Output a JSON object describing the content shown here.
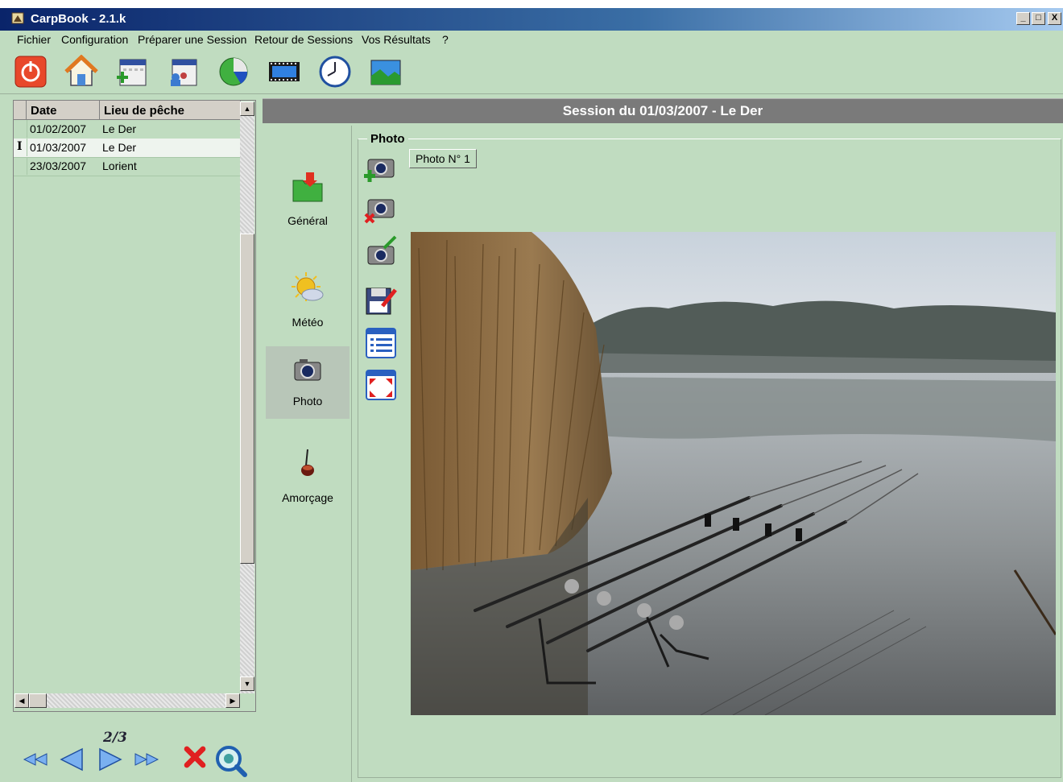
{
  "window": {
    "title": "CarpBook - 2.1.k",
    "min": "_",
    "max": "□",
    "close": "X"
  },
  "menu": {
    "items": [
      {
        "label": "Fichier"
      },
      {
        "label": "Configuration"
      },
      {
        "label": "Préparer une Session"
      },
      {
        "label": "Retour de Sessions"
      },
      {
        "label": "Vos Résultats"
      },
      {
        "label": "?"
      }
    ]
  },
  "toolbar": {
    "icons": [
      "power-icon",
      "home-icon",
      "calendar-add-icon",
      "calendar-people-icon",
      "pie-chart-icon",
      "film-icon",
      "clock-icon",
      "landscape-icon"
    ]
  },
  "grid": {
    "columns": [
      "Date",
      "Lieu de pêche"
    ],
    "rows": [
      {
        "date": "01/02/2007",
        "lieu": "Le Der",
        "selected": false
      },
      {
        "date": "01/03/2007",
        "lieu": "Le Der",
        "selected": true
      },
      {
        "date": "23/03/2007",
        "lieu": "Lorient",
        "selected": false
      }
    ],
    "cursor_marker": "I"
  },
  "pager": {
    "counter": "2/3"
  },
  "session": {
    "header": "Session du 01/03/2007 - Le Der"
  },
  "sidenav": {
    "items": [
      {
        "label": "Général",
        "icon": "folder-icon"
      },
      {
        "label": "Météo",
        "icon": "weather-icon"
      },
      {
        "label": "Photo",
        "icon": "camera-icon",
        "active": true
      },
      {
        "label": "Amorçage",
        "icon": "bait-icon"
      }
    ]
  },
  "photo": {
    "group_title": "Photo",
    "tab_label": "Photo N° 1",
    "tools": [
      "add-photo-icon",
      "delete-photo-icon",
      "edit-photo-icon",
      "save-photo-icon",
      "details-icon",
      "fullscreen-icon"
    ]
  },
  "colors": {
    "background": "#c0dcc0",
    "titlebar": "#0a246a",
    "header": "#7a7a7a"
  }
}
